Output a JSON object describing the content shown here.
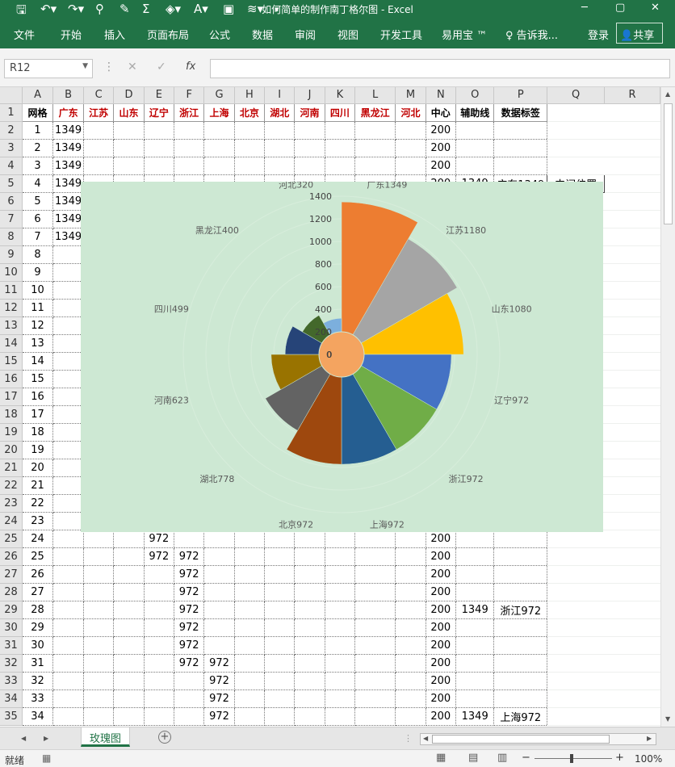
{
  "title_bar": {
    "title": "如何简单的制作南丁格尔图 - Excel",
    "qat": [
      "save-icon",
      "undo-icon",
      "redo-icon",
      "add-person-icon",
      "brush-icon",
      "sum-icon",
      "fill-color-icon",
      "font-color-icon",
      "picture-icon",
      "chart-icon",
      "more-icon"
    ],
    "window_buttons": [
      "─",
      "▢",
      "✕"
    ]
  },
  "ribbon": {
    "tabs": [
      "文件",
      "开始",
      "插入",
      "页面布局",
      "公式",
      "数据",
      "审阅",
      "视图",
      "开发工具",
      "易用宝 ™"
    ],
    "tell_me": "告诉我...",
    "login": "登录",
    "share": "共享"
  },
  "formula_bar": {
    "name_box": "R12",
    "fx": "fx",
    "value": ""
  },
  "columns": [
    "A",
    "B",
    "C",
    "D",
    "E",
    "F",
    "G",
    "H",
    "I",
    "J",
    "K",
    "L",
    "M",
    "N",
    "O",
    "P",
    "Q",
    "R"
  ],
  "header_row": [
    "网格",
    "广东",
    "江苏",
    "山东",
    "辽宁",
    "浙江",
    "上海",
    "北京",
    "湖北",
    "河南",
    "四川",
    "黑龙江",
    "河北",
    "中心",
    "辅助线",
    "数据标签",
    "",
    ""
  ],
  "rows": [
    [
      "1",
      "1349",
      "",
      "",
      "",
      "",
      "",
      "",
      "",
      "",
      "",
      "",
      "",
      "200",
      "",
      "",
      "",
      ""
    ],
    [
      "2",
      "1349",
      "",
      "",
      "",
      "",
      "",
      "",
      "",
      "",
      "",
      "",
      "",
      "200",
      "",
      "",
      "",
      ""
    ],
    [
      "3",
      "1349",
      "",
      "",
      "",
      "",
      "",
      "",
      "",
      "",
      "",
      "",
      "",
      "200",
      "",
      "",
      "",
      ""
    ],
    [
      "4",
      "1349",
      "",
      "",
      "",
      "",
      "",
      "",
      "",
      "",
      "",
      "",
      "",
      "200",
      "1349",
      "广东1349",
      "中间位置",
      ""
    ],
    [
      "5",
      "1349",
      "",
      "",
      "",
      "",
      "",
      "",
      "",
      "",
      "",
      "",
      "",
      "200",
      "",
      "",
      "",
      ""
    ],
    [
      "6",
      "1349",
      "",
      "",
      "",
      "",
      "",
      "",
      "",
      "",
      "",
      "",
      "",
      "200",
      "",
      "",
      "",
      ""
    ],
    [
      "7",
      "1349",
      "",
      "",
      "",
      "",
      "",
      "",
      "",
      "",
      "",
      "",
      "",
      "200",
      "",
      "",
      "",
      ""
    ],
    [
      "8",
      "",
      "",
      "",
      "",
      "",
      "",
      "",
      "",
      "",
      "",
      "",
      "",
      "200",
      "",
      "",
      "",
      ""
    ],
    [
      "9",
      "",
      "",
      "",
      "",
      "",
      "",
      "",
      "",
      "",
      "",
      "",
      "",
      "200",
      "",
      "",
      "",
      ""
    ],
    [
      "10",
      "",
      "",
      "",
      "",
      "",
      "",
      "",
      "",
      "",
      "",
      "",
      "",
      "200",
      "",
      "",
      "",
      ""
    ],
    [
      "11",
      "",
      "",
      "",
      "",
      "",
      "",
      "",
      "",
      "",
      "",
      "",
      "",
      "200",
      "",
      "",
      "",
      ""
    ],
    [
      "12",
      "",
      "",
      "",
      "",
      "",
      "",
      "",
      "",
      "",
      "",
      "",
      "",
      "200",
      "",
      "",
      "",
      ""
    ],
    [
      "13",
      "",
      "",
      "",
      "",
      "",
      "",
      "",
      "",
      "",
      "",
      "",
      "",
      "200",
      "",
      "",
      "",
      ""
    ],
    [
      "14",
      "",
      "",
      "",
      "",
      "",
      "",
      "",
      "",
      "",
      "",
      "",
      "",
      "200",
      "",
      "",
      "",
      ""
    ],
    [
      "15",
      "",
      "",
      "",
      "",
      "",
      "",
      "",
      "",
      "",
      "",
      "",
      "",
      "200",
      "",
      "",
      "",
      ""
    ],
    [
      "16",
      "",
      "",
      "",
      "",
      "",
      "",
      "",
      "",
      "",
      "",
      "",
      "",
      "200",
      "",
      "",
      "",
      ""
    ],
    [
      "17",
      "",
      "",
      "",
      "",
      "",
      "",
      "",
      "",
      "",
      "",
      "",
      "",
      "200",
      "",
      "",
      "",
      ""
    ],
    [
      "18",
      "",
      "",
      "",
      "",
      "",
      "",
      "",
      "",
      "",
      "",
      "",
      "",
      "200",
      "",
      "",
      "",
      ""
    ],
    [
      "19",
      "",
      "",
      "",
      "",
      "",
      "",
      "",
      "",
      "",
      "",
      "",
      "",
      "200",
      "",
      "",
      "",
      ""
    ],
    [
      "20",
      "",
      "",
      "",
      "",
      "",
      "",
      "",
      "",
      "",
      "",
      "",
      "",
      "200",
      "",
      "",
      "",
      ""
    ],
    [
      "21",
      "",
      "",
      "",
      "",
      "",
      "",
      "",
      "",
      "",
      "",
      "",
      "",
      "200",
      "",
      "",
      "",
      ""
    ],
    [
      "22",
      "",
      "",
      "",
      "",
      "",
      "",
      "",
      "",
      "",
      "",
      "",
      "",
      "200",
      "",
      "",
      "",
      ""
    ],
    [
      "23",
      "",
      "",
      "",
      "",
      "",
      "",
      "",
      "",
      "",
      "",
      "",
      "",
      "200",
      "",
      "",
      "",
      ""
    ],
    [
      "24",
      "",
      "",
      "",
      "972",
      "",
      "",
      "",
      "",
      "",
      "",
      "",
      "",
      "200",
      "",
      "",
      "",
      ""
    ],
    [
      "25",
      "",
      "",
      "",
      "972",
      "972",
      "",
      "",
      "",
      "",
      "",
      "",
      "",
      "200",
      "",
      "",
      "",
      ""
    ],
    [
      "26",
      "",
      "",
      "",
      "",
      "972",
      "",
      "",
      "",
      "",
      "",
      "",
      "",
      "200",
      "",
      "",
      "",
      ""
    ],
    [
      "27",
      "",
      "",
      "",
      "",
      "972",
      "",
      "",
      "",
      "",
      "",
      "",
      "",
      "200",
      "",
      "",
      "",
      ""
    ],
    [
      "28",
      "",
      "",
      "",
      "",
      "972",
      "",
      "",
      "",
      "",
      "",
      "",
      "",
      "200",
      "1349",
      "浙江972",
      "",
      ""
    ],
    [
      "29",
      "",
      "",
      "",
      "",
      "972",
      "",
      "",
      "",
      "",
      "",
      "",
      "",
      "200",
      "",
      "",
      "",
      ""
    ],
    [
      "30",
      "",
      "",
      "",
      "",
      "972",
      "",
      "",
      "",
      "",
      "",
      "",
      "",
      "200",
      "",
      "",
      "",
      ""
    ],
    [
      "31",
      "",
      "",
      "",
      "",
      "972",
      "972",
      "",
      "",
      "",
      "",
      "",
      "",
      "200",
      "",
      "",
      "",
      ""
    ],
    [
      "32",
      "",
      "",
      "",
      "",
      "",
      "972",
      "",
      "",
      "",
      "",
      "",
      "",
      "200",
      "",
      "",
      "",
      ""
    ],
    [
      "33",
      "",
      "",
      "",
      "",
      "",
      "972",
      "",
      "",
      "",
      "",
      "",
      "",
      "200",
      "",
      "",
      "",
      ""
    ],
    [
      "34",
      "",
      "",
      "",
      "",
      "",
      "972",
      "",
      "",
      "",
      "",
      "",
      "",
      "200",
      "1349",
      "上海972",
      "",
      ""
    ]
  ],
  "sheet_tab": "玫瑰图",
  "status": {
    "ready": "就绪",
    "zoom": "100%"
  },
  "chart_data": {
    "type": "pie",
    "subtype": "rose",
    "categories": [
      "广东",
      "江苏",
      "山东",
      "辽宁",
      "浙江",
      "上海",
      "北京",
      "湖北",
      "河南",
      "四川",
      "黑龙江",
      "河北"
    ],
    "values": [
      1349,
      1180,
      1080,
      972,
      972,
      972,
      972,
      778,
      623,
      499,
      400,
      320
    ],
    "labels": [
      "广东1349",
      "江苏1180",
      "山东1080",
      "辽宁972",
      "浙江972",
      "上海972",
      "北京972",
      "湖北778",
      "河南623",
      "四川499",
      "黑龙江400",
      "河北320"
    ],
    "colors": [
      "#ed7d31",
      "#a5a5a5",
      "#ffc000",
      "#4472c4",
      "#70ad47",
      "#255e91",
      "#9e480e",
      "#636363",
      "#997300",
      "#264478",
      "#43682b",
      "#7cafdd"
    ],
    "center_value": 200,
    "center_color": "#f4a460",
    "center_label": "0",
    "radial_ticks": [
      0,
      200,
      400,
      600,
      800,
      1000,
      1200,
      1400
    ],
    "rmax": 1400
  }
}
